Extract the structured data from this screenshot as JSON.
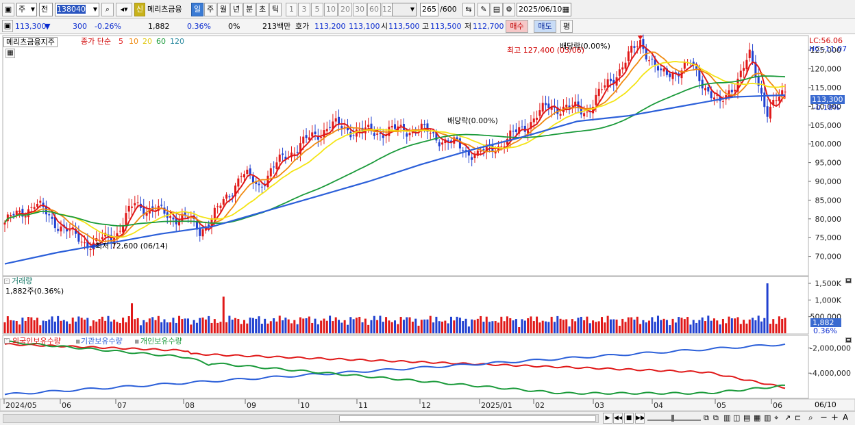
{
  "toolbar": {
    "market": "주",
    "type": "전",
    "code": "138040",
    "name": "메리츠금융",
    "badge": "신",
    "periods": [
      "일",
      "주",
      "월",
      "년",
      "분",
      "초",
      "틱"
    ],
    "active_period": "일",
    "intervals": [
      "1",
      "3",
      "5",
      "10",
      "20",
      "30",
      "60",
      "120"
    ],
    "count": "265",
    "count_max": "/600",
    "date": "2025/06/10"
  },
  "quote": {
    "price": "113,300",
    "arrow": "▼",
    "change": "300",
    "pct": "-0.26%",
    "volume": "1,882",
    "vol_pct": "0.36%",
    "credit": "0%",
    "amount": "213백만",
    "hoga_label": "호가",
    "ask": "113,200",
    "bid": "113,100",
    "open_label": "시",
    "open": "113,500",
    "high_label": "고",
    "high": "113,500",
    "low_label": "저",
    "low": "112,700",
    "buy": "매수",
    "sell": "매도",
    "eval": "평"
  },
  "price_panel": {
    "stock": "메리츠금융지주",
    "ma_label": "종가 단순",
    "ma_periods": [
      "5",
      "10",
      "20",
      "60",
      "120"
    ],
    "ma_colors": [
      "#e01818",
      "#f08a10",
      "#f4e414",
      "#1a9a3a",
      "#2b5fd9"
    ],
    "lc": "LC:56.06",
    "hc": "HC:-11.07",
    "y_ticks": [
      "125,000",
      "120,000",
      "115,000",
      "110,000",
      "105,000",
      "100,000",
      "95,000",
      "90,000",
      "85,000",
      "80,000",
      "75,000",
      "70,000"
    ],
    "cur_price": "113,300",
    "cur_pct": "-0.18%",
    "ann_high": "최고 127,400 (03/06)",
    "ann_low": "최저 72,600 (06/14)",
    "ann_div1": "배당락(0.00%)",
    "ann_div2": "배당락(0.00%)"
  },
  "volume_panel": {
    "title": "거래량",
    "sub": "1,882주(0.36%)",
    "y_ticks": [
      "1,500K",
      "1,000K",
      "500,000"
    ],
    "cur": "1,882",
    "cur_pct": "0.36%"
  },
  "holdings_panel": {
    "series": [
      "외국인보유수량",
      "기관보유수량",
      "개인보유수량"
    ],
    "colors": [
      "#e01818",
      "#2b5fd9",
      "#1a9a3a"
    ],
    "y_ticks": [
      "-2,000,000",
      "-4,000,000"
    ]
  },
  "x_axis": {
    "labels": [
      "2024/05",
      "06",
      "07",
      "08",
      "09",
      "10",
      "11",
      "12",
      "2025/01",
      "02",
      "03",
      "04",
      "05",
      "06"
    ],
    "cur": "06/10"
  },
  "chart_data": {
    "type": "line",
    "price": {
      "x": [
        "2024-05",
        "2024-06",
        "2024-06-14",
        "2024-07",
        "2024-08",
        "2024-09",
        "2024-10",
        "2024-11",
        "2024-12",
        "2025-01",
        "2025-02",
        "2025-03",
        "2025-03-06",
        "2025-04",
        "2025-05",
        "2025-06-10"
      ],
      "close": [
        79000,
        79500,
        72600,
        78000,
        80000,
        91000,
        98000,
        104000,
        101000,
        100000,
        110000,
        122000,
        127400,
        113000,
        118000,
        113300
      ],
      "ma120": [
        68000,
        71000,
        73500,
        76000,
        78000,
        82000,
        86000,
        90000,
        94500,
        98500,
        102000,
        106000,
        107500,
        110000,
        112500,
        113000
      ]
    },
    "volume_max": 1500000,
    "holdings_range": [
      -6000000,
      -1000000
    ]
  }
}
